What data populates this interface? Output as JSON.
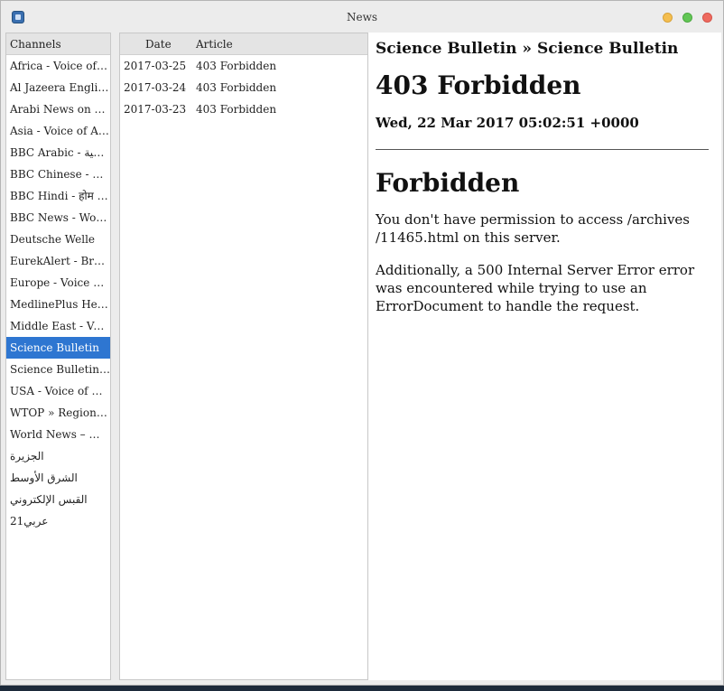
{
  "window": {
    "title": "News"
  },
  "channels": {
    "header": "Channels",
    "items": [
      "Africa - Voice of America",
      "Al Jazeera English",
      "Arabi News on The New Arab",
      "Asia - Voice of America",
      "BBC Arabic - الرئيسية",
      "BBC Chinese - 主页",
      "BBC Hindi - होम पेज",
      "BBC News - World",
      "Deutsche Welle",
      "EurekAlert - Breaking News",
      "Europe - Voice of America",
      "MedlinePlus Health News",
      "Middle East - Voice of America",
      "Science Bulletin",
      "Science Bulletin » Science Bulletin",
      "USA - Voice of America",
      "WTOP » Regions » World",
      "World News – WTOP",
      "الجزيرة",
      "الشرق الأوسط",
      "القبس الإلكتروني",
      "عربي21"
    ],
    "selected_index": 13
  },
  "articles": {
    "header_date": "Date",
    "header_article": "Article",
    "rows": [
      {
        "date": "2017-03-25",
        "title": "403 Forbidden"
      },
      {
        "date": "2017-03-24",
        "title": "403 Forbidden"
      },
      {
        "date": "2017-03-23",
        "title": "403 Forbidden"
      }
    ]
  },
  "content": {
    "feed_title": "Science Bulletin » Science Bulletin",
    "heading": "403 Forbidden",
    "date": "Wed, 22 Mar 2017 05:02:51 +0000",
    "subheading": "Forbidden",
    "paragraph1": "You don't have permission to access /archives /11465.html on this server.",
    "paragraph2": "Additionally, a 500 Internal Server Error error was encountered while trying to use an ErrorDocument to handle the request."
  },
  "colors": {
    "selection": "#2e76d1",
    "minimize": "#f4be4f",
    "maximize": "#62c655",
    "close": "#ee6a5f"
  }
}
